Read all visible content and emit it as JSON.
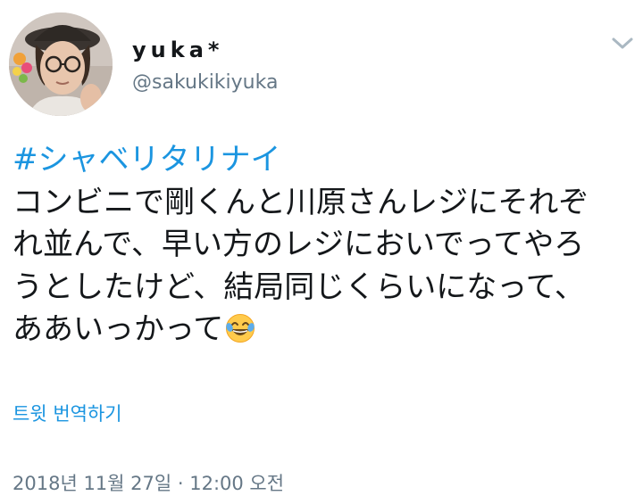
{
  "user": {
    "display_name": "yuka*",
    "handle": "@sakukikiyuka",
    "avatar_icon": "profile-photo"
  },
  "menu": {
    "icon": "chevron-down-icon"
  },
  "tweet": {
    "hashtag": "#シャベリタリナイ",
    "lines": [
      "コンビニで剛くんと川原さんレジにそれぞ",
      "れ並んで、早い方のレジにおいでってやろ",
      "うとしたけど、結局同じくらいになって、",
      "ああいっかって"
    ],
    "emoji": "face-with-tears-of-joy",
    "translate_label": "트윗 번역하기",
    "timestamp": "2018년 11월 27일 · 12:00 오전"
  },
  "colors": {
    "link": "#1b95e0",
    "text": "#14171a",
    "secondary": "#657786",
    "background": "#ffffff"
  }
}
